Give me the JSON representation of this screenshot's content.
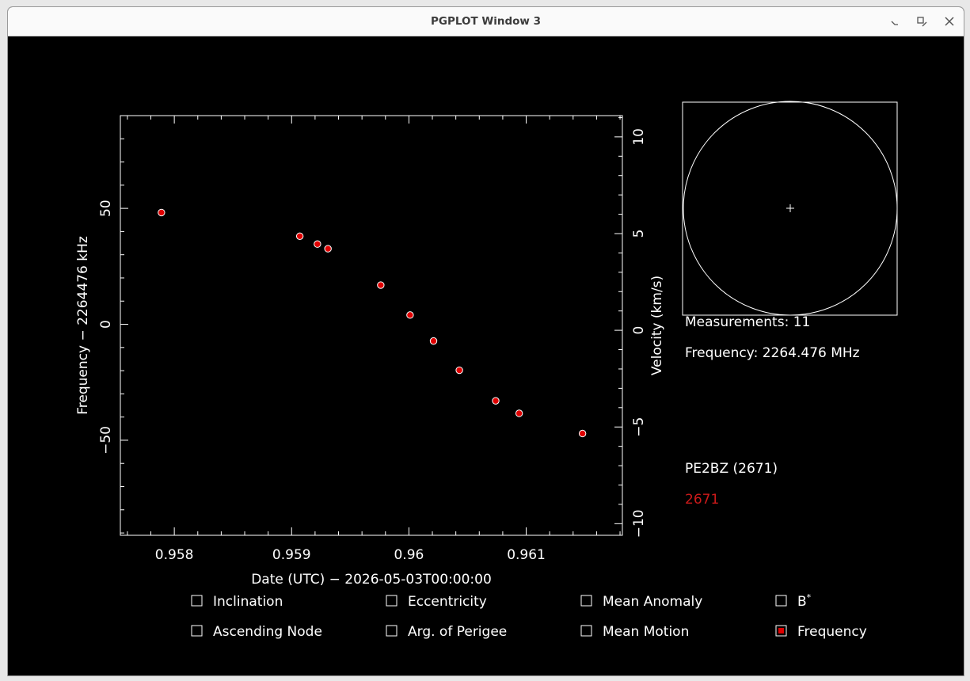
{
  "window": {
    "title": "PGPLOT Window 3"
  },
  "icons": {
    "minimize": "minimize-icon",
    "maximize": "maximize-icon",
    "close": "close-icon"
  },
  "colors": {
    "background": "#000000",
    "foreground": "#ffffff",
    "marker": "#e00000",
    "highlight": "#cc1a1a"
  },
  "chart_data": {
    "type": "scatter",
    "xlabel": "Date (UTC) − 2026-05-03T00:00:00",
    "ylabel": "Frequency − 2264476 kHz",
    "y2label": "Velocity (km/s)",
    "xlim": [
      0.95754,
      0.96182
    ],
    "ylim": [
      -91,
      90
    ],
    "y2lim": [
      -10.6,
      11.1
    ],
    "xticks": [
      {
        "value": 0.958,
        "label": "0.958"
      },
      {
        "value": 0.959,
        "label": "0.959"
      },
      {
        "value": 0.96,
        "label": "0.96"
      },
      {
        "value": 0.961,
        "label": "0.961"
      }
    ],
    "yticks": [
      {
        "value": 50,
        "label": "50"
      },
      {
        "value": 0,
        "label": "0"
      },
      {
        "value": -50,
        "label": "−50"
      }
    ],
    "y2ticks": [
      {
        "value": 10,
        "label": "10"
      },
      {
        "value": 5,
        "label": "5"
      },
      {
        "value": 0,
        "label": "0"
      },
      {
        "value": -5,
        "label": "−5"
      },
      {
        "value": -10,
        "label": "−10"
      }
    ],
    "points": [
      {
        "x": 0.95789,
        "y": 48.2
      },
      {
        "x": 0.95907,
        "y": 38.0
      },
      {
        "x": 0.95922,
        "y": 34.6
      },
      {
        "x": 0.95931,
        "y": 32.6
      },
      {
        "x": 0.95976,
        "y": 16.9
      },
      {
        "x": 0.96001,
        "y": 4.0
      },
      {
        "x": 0.96021,
        "y": -7.2
      },
      {
        "x": 0.96043,
        "y": -19.8
      },
      {
        "x": 0.96074,
        "y": -33.0
      },
      {
        "x": 0.96094,
        "y": -38.4
      },
      {
        "x": 0.96148,
        "y": -47.1
      }
    ]
  },
  "info": {
    "measurements": "Measurements: 11",
    "frequency": "Frequency: 2264.476 MHz",
    "station": "PE2BZ (2671)",
    "station_id": "2671"
  },
  "checkboxes": [
    {
      "label": "Inclination",
      "checked": false
    },
    {
      "label": "Eccentricity",
      "checked": false
    },
    {
      "label": "Mean Anomaly",
      "checked": false
    },
    {
      "label": "B",
      "sup": "*",
      "checked": false
    },
    {
      "label": "Ascending Node",
      "checked": false
    },
    {
      "label": "Arg. of Perigee",
      "checked": false
    },
    {
      "label": "Mean Motion",
      "checked": false
    },
    {
      "label": "Frequency",
      "checked": true
    }
  ]
}
